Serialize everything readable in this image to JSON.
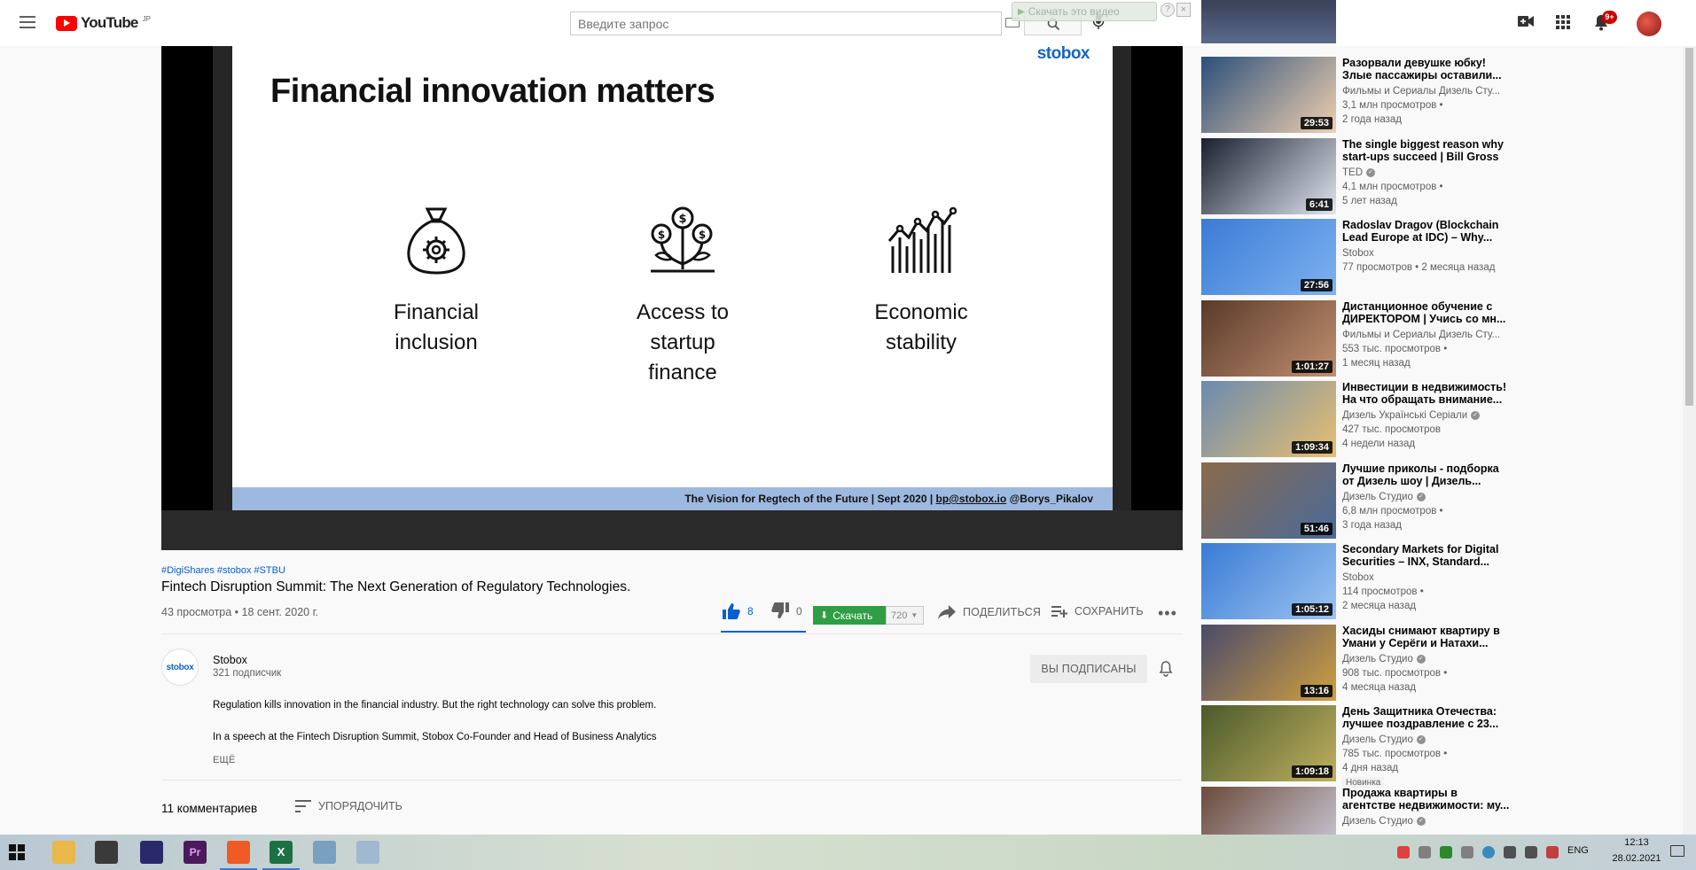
{
  "header": {
    "logo_text": "YouTube",
    "logo_country": "JP",
    "search_placeholder": "Введите запрос",
    "download_overlay": "Скачать это видео",
    "notifications_badge": "9+"
  },
  "slide": {
    "title": "Financial innovation matters",
    "brand": "stobox",
    "items": [
      {
        "label": "Financial\ninclusion",
        "icon": "money-bag-gear-icon"
      },
      {
        "label": "Access to\nstartup\nfinance",
        "icon": "coin-plant-icon"
      },
      {
        "label": "Economic\nstability",
        "icon": "chart-growth-icon"
      }
    ],
    "footer_text": "The Vision for Regtech of the Future | Sept 2020 |",
    "footer_email": "bp@stobox.io",
    "footer_handle": "@Borys_Pikalov"
  },
  "video": {
    "hashtags": [
      "#DigiShares",
      "#stobox",
      "#STBU"
    ],
    "title": "Fintech Disruption Summit: The Next Generation of Regulatory Technologies.",
    "meta": "43 просмотра • 18 сент. 2020 г.",
    "likes": "8",
    "dislikes": "0",
    "download_label": "Скачать",
    "quality": "720",
    "share_label": "ПОДЕЛИТЬСЯ",
    "save_label": "СОХРАНИТЬ"
  },
  "channel": {
    "avatar_text": "stobox",
    "name": "Stobox",
    "subscribers": "321 подписчик",
    "subscribed_label": "ВЫ ПОДПИСАНЫ"
  },
  "description": {
    "line1": "Regulation kills innovation in the financial industry. But the right technology can solve this problem.",
    "line2": "In a speech at the Fintech Disruption Summit, Stobox Co-Founder and Head of Business Analytics",
    "more_label": "ЕЩЁ"
  },
  "comments": {
    "count_label": "11 комментариев",
    "sort_label": "УПОРЯДОЧИТЬ"
  },
  "recommendations": [
    {
      "title": "Разорвали девушке юбку! Злые пассажиры оставили...",
      "channel": "Фильмы и Сериалы Дизель Сту...",
      "verified": false,
      "views": "3,1 млн просмотров •",
      "age": "2 года назад",
      "duration": "29:53",
      "thumb": [
        "#2a4f7a",
        "#f0d0b0"
      ]
    },
    {
      "title": "The single biggest reason why start-ups succeed | Bill Gross",
      "channel": "TED",
      "verified": true,
      "views": "4,1 млн просмотров •",
      "age": "5 лет назад",
      "duration": "6:41",
      "thumb": [
        "#1a1f2e",
        "#e0e6f0"
      ]
    },
    {
      "title": "Radoslav Dragov (Blockchain Lead Europe at IDC) – Why...",
      "channel": "Stobox",
      "verified": false,
      "views": "77 просмотров • 2 месяца назад",
      "age": "",
      "duration": "27:56",
      "thumb": [
        "#3a7bd5",
        "#7fb3f0"
      ]
    },
    {
      "title": "Дистанционное обучение с ДИРЕКТОРОМ | Учись со мн...",
      "channel": "Фильмы и Сериалы Дизель Сту...",
      "verified": false,
      "views": "553 тыс. просмотров •",
      "age": "1 месяц назад",
      "duration": "1:01:27",
      "thumb": [
        "#5a3a2a",
        "#c09070"
      ]
    },
    {
      "title": "Инвестиции в недвижимость! На что обращать внимание...",
      "channel": "Дизель Українські Серіали",
      "verified": true,
      "views": "427 тыс. просмотров",
      "age": "4 недели назад",
      "duration": "1:09:34",
      "thumb": [
        "#6a8ab0",
        "#e8c070"
      ]
    },
    {
      "title": "Лучшие приколы - подборка от Дизель шоу | Дизель...",
      "channel": "Дизель Студио",
      "verified": true,
      "views": "6,8 млн просмотров •",
      "age": "3 года назад",
      "duration": "51:46",
      "thumb": [
        "#8a6a4a",
        "#4a6a9a"
      ]
    },
    {
      "title": "Secondary Markets for Digital Securities – INX, Standard...",
      "channel": "Stobox",
      "verified": false,
      "views": "114 просмотров •",
      "age": "2 месяца назад",
      "duration": "1:05:12",
      "thumb": [
        "#3a7bd5",
        "#9cc4f0"
      ]
    },
    {
      "title": "Хасиды снимают квартиру в Умани у Серёги и Натахи...",
      "channel": "Дизель Студио",
      "verified": true,
      "views": "908 тыс. просмотров •",
      "age": "4 месяца назад",
      "duration": "13:16",
      "thumb": [
        "#4a4a6a",
        "#d0a040"
      ]
    },
    {
      "title": "День Защитника Отечества: лучшее поздравление с 23...",
      "channel": "Дизель Студио",
      "verified": true,
      "views": "785 тыс. просмотров •",
      "age": "4 дня назад",
      "duration": "1:09:18",
      "thumb": [
        "#4a5a2a",
        "#c0b060"
      ],
      "badge": "Новинка"
    },
    {
      "title": "Продажа квартиры в агентстве недвижимости: му...",
      "channel": "Дизель Студио",
      "verified": true,
      "views": "",
      "age": "",
      "duration": "",
      "thumb": [
        "#6a4a3a",
        "#d0d0e0"
      ]
    }
  ],
  "taskbar": {
    "language": "ENG",
    "time": "12:13",
    "date": "28.02.2021"
  }
}
